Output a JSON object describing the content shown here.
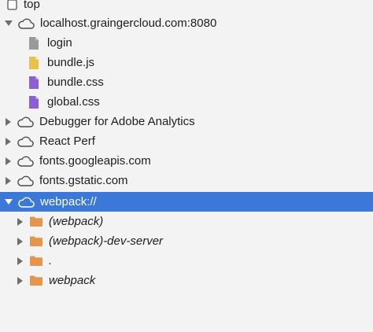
{
  "tree": {
    "top_label": "top",
    "host_localhost": {
      "label": "localhost.graingercloud.com:8080",
      "files": [
        {
          "label": "login",
          "color": "#9a9a9a"
        },
        {
          "label": "bundle.js",
          "color": "#e8c24f"
        },
        {
          "label": "bundle.css",
          "color": "#8e5fd4"
        },
        {
          "label": "global.css",
          "color": "#8e5fd4"
        }
      ]
    },
    "hosts": [
      {
        "label": "Debugger for Adobe Analytics"
      },
      {
        "label": "React Perf"
      },
      {
        "label": "fonts.googleapis.com"
      },
      {
        "label": "fonts.gstatic.com"
      }
    ],
    "webpack": {
      "label": "webpack://",
      "folders": [
        {
          "label": "(webpack)"
        },
        {
          "label": "(webpack)-dev-server"
        },
        {
          "label": "."
        },
        {
          "label": "webpack"
        }
      ]
    }
  },
  "colors": {
    "selection": "#3b78d8",
    "folder": "#e4964f",
    "arrow": "#6e6e6e"
  }
}
